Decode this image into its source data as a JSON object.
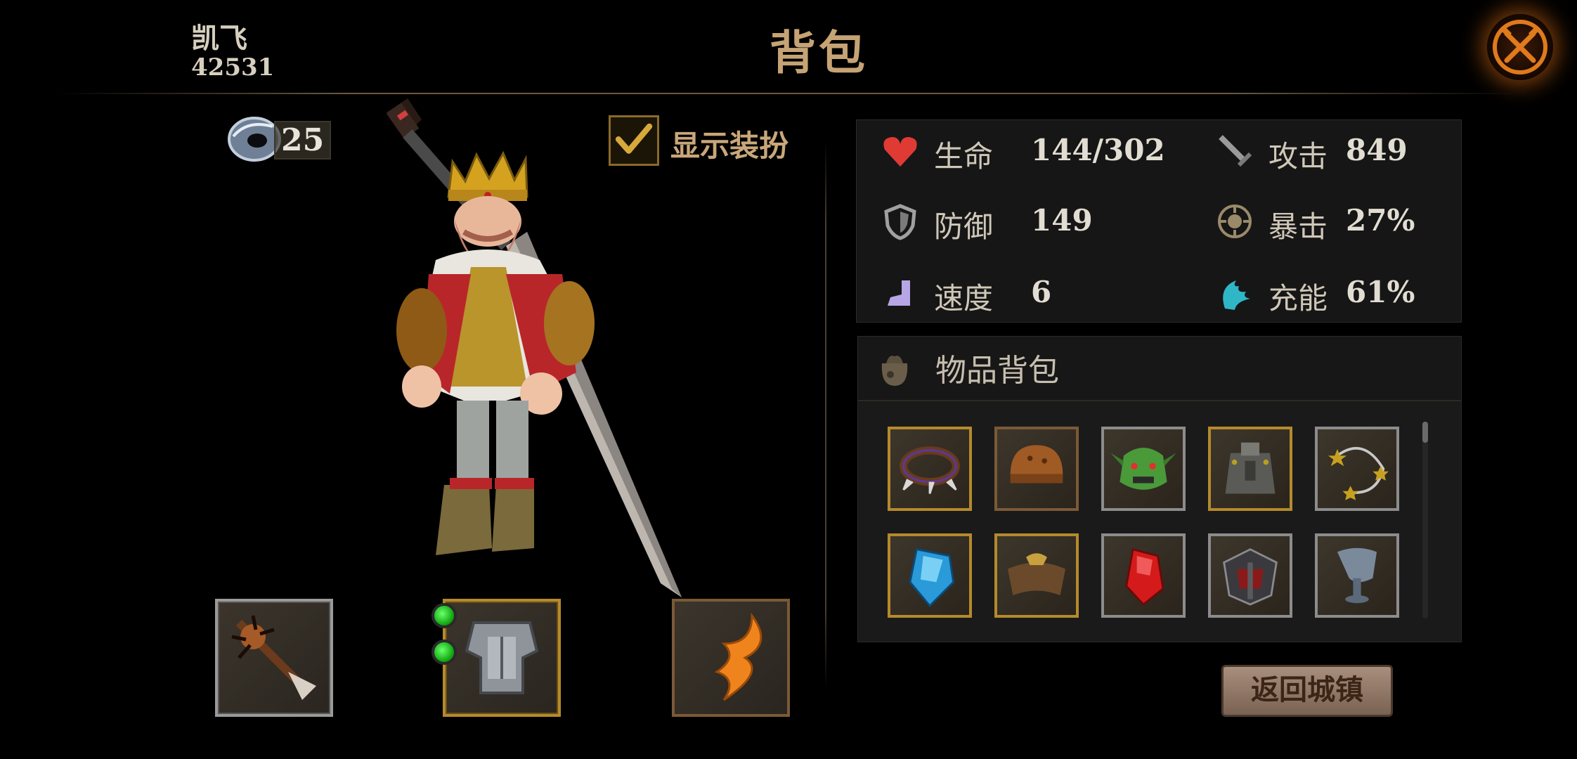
{
  "header": {
    "player_name": "凯飞",
    "player_id": "42531",
    "title": "背包",
    "close_icon": "close-crossed-tools-icon"
  },
  "currency": {
    "icon": "ring-token-icon",
    "count": "25"
  },
  "show_outfit": {
    "label": "显示装扮",
    "checked": true
  },
  "equipment": [
    {
      "slot": "weapon",
      "icon": "spiked-mace-icon",
      "frame": "silver"
    },
    {
      "slot": "armor",
      "icon": "plate-armor-icon",
      "frame": "gold",
      "gems": 2
    },
    {
      "slot": "accessory",
      "icon": "flame-horn-icon",
      "frame": "bronze"
    }
  ],
  "stats": [
    {
      "icon": "heart-icon",
      "name": "生命",
      "value": "144/302"
    },
    {
      "icon": "sword-icon",
      "name": "攻击",
      "value": "849"
    },
    {
      "icon": "shield-icon",
      "name": "防御",
      "value": "149"
    },
    {
      "icon": "crit-target-icon",
      "name": "暴击",
      "value": "27%"
    },
    {
      "icon": "boot-icon",
      "name": "速度",
      "value": "6"
    },
    {
      "icon": "energy-claw-icon",
      "name": "充能",
      "value": "61%"
    }
  ],
  "inventory": {
    "title": "物品背包",
    "icon": "bag-icon",
    "items": [
      {
        "icon": "spiked-collar-icon",
        "frame": "gold"
      },
      {
        "icon": "leather-helmet-icon",
        "frame": "bronze"
      },
      {
        "icon": "goblin-mask-icon",
        "frame": "silver"
      },
      {
        "icon": "backpack-armor-icon",
        "frame": "gold"
      },
      {
        "icon": "star-flail-icon",
        "frame": "silver"
      },
      {
        "icon": "blue-crystal-icon",
        "frame": "gold"
      },
      {
        "icon": "winged-pauldron-icon",
        "frame": "gold"
      },
      {
        "icon": "red-gem-icon",
        "frame": "silver"
      },
      {
        "icon": "dark-helm-icon",
        "frame": "silver"
      },
      {
        "icon": "iron-grail-icon",
        "frame": "silver"
      }
    ]
  },
  "return_button": {
    "label": "返回城镇"
  }
}
